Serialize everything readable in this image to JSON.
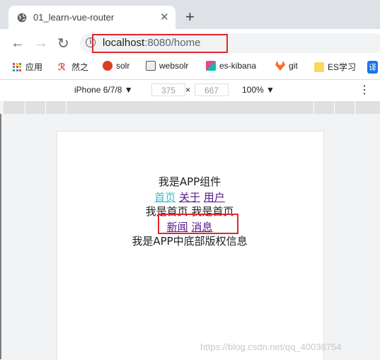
{
  "browser": {
    "tab_title": "01_learn-vue-router",
    "tab_close": "✕",
    "new_tab": "+",
    "url_host": "localhost",
    "url_rest": ":8080/home"
  },
  "bookmarks": [
    {
      "label": "应用",
      "icon": "apps-icon",
      "color": "#e94235"
    },
    {
      "label": "然之",
      "icon": "ranzhi-icon",
      "color": "#ea4335"
    },
    {
      "label": "solr",
      "icon": "solr-icon",
      "color": "#d9411e"
    },
    {
      "label": "websolr",
      "icon": "websolr-icon",
      "color": "#555555"
    },
    {
      "label": "es-kibana",
      "icon": "kibana-icon",
      "color": "#e8478b"
    },
    {
      "label": "git",
      "icon": "gitlab-icon",
      "color": "#fc6d26"
    },
    {
      "label": "ES学习",
      "icon": "folder-icon",
      "color": "#fbd75b"
    },
    {
      "label": "译",
      "icon": "translate-icon",
      "color": "#1a73e8"
    }
  ],
  "devtools": {
    "device": "iPhone 6/7/8 ▼",
    "width": "375",
    "times": "×",
    "height": "667",
    "zoom": "100% ▼",
    "menu": "⋮"
  },
  "page": {
    "app_title": "我是APP组件",
    "nav": {
      "home": "首页",
      "about": "关于",
      "user": "用户"
    },
    "home_text": "我是首页 我是首页",
    "sub_nav": {
      "news": "新闻",
      "message": "消息"
    },
    "footer": "我是APP中底部版权信息"
  },
  "watermark": "https://blog.csdn.net/qq_40036754"
}
